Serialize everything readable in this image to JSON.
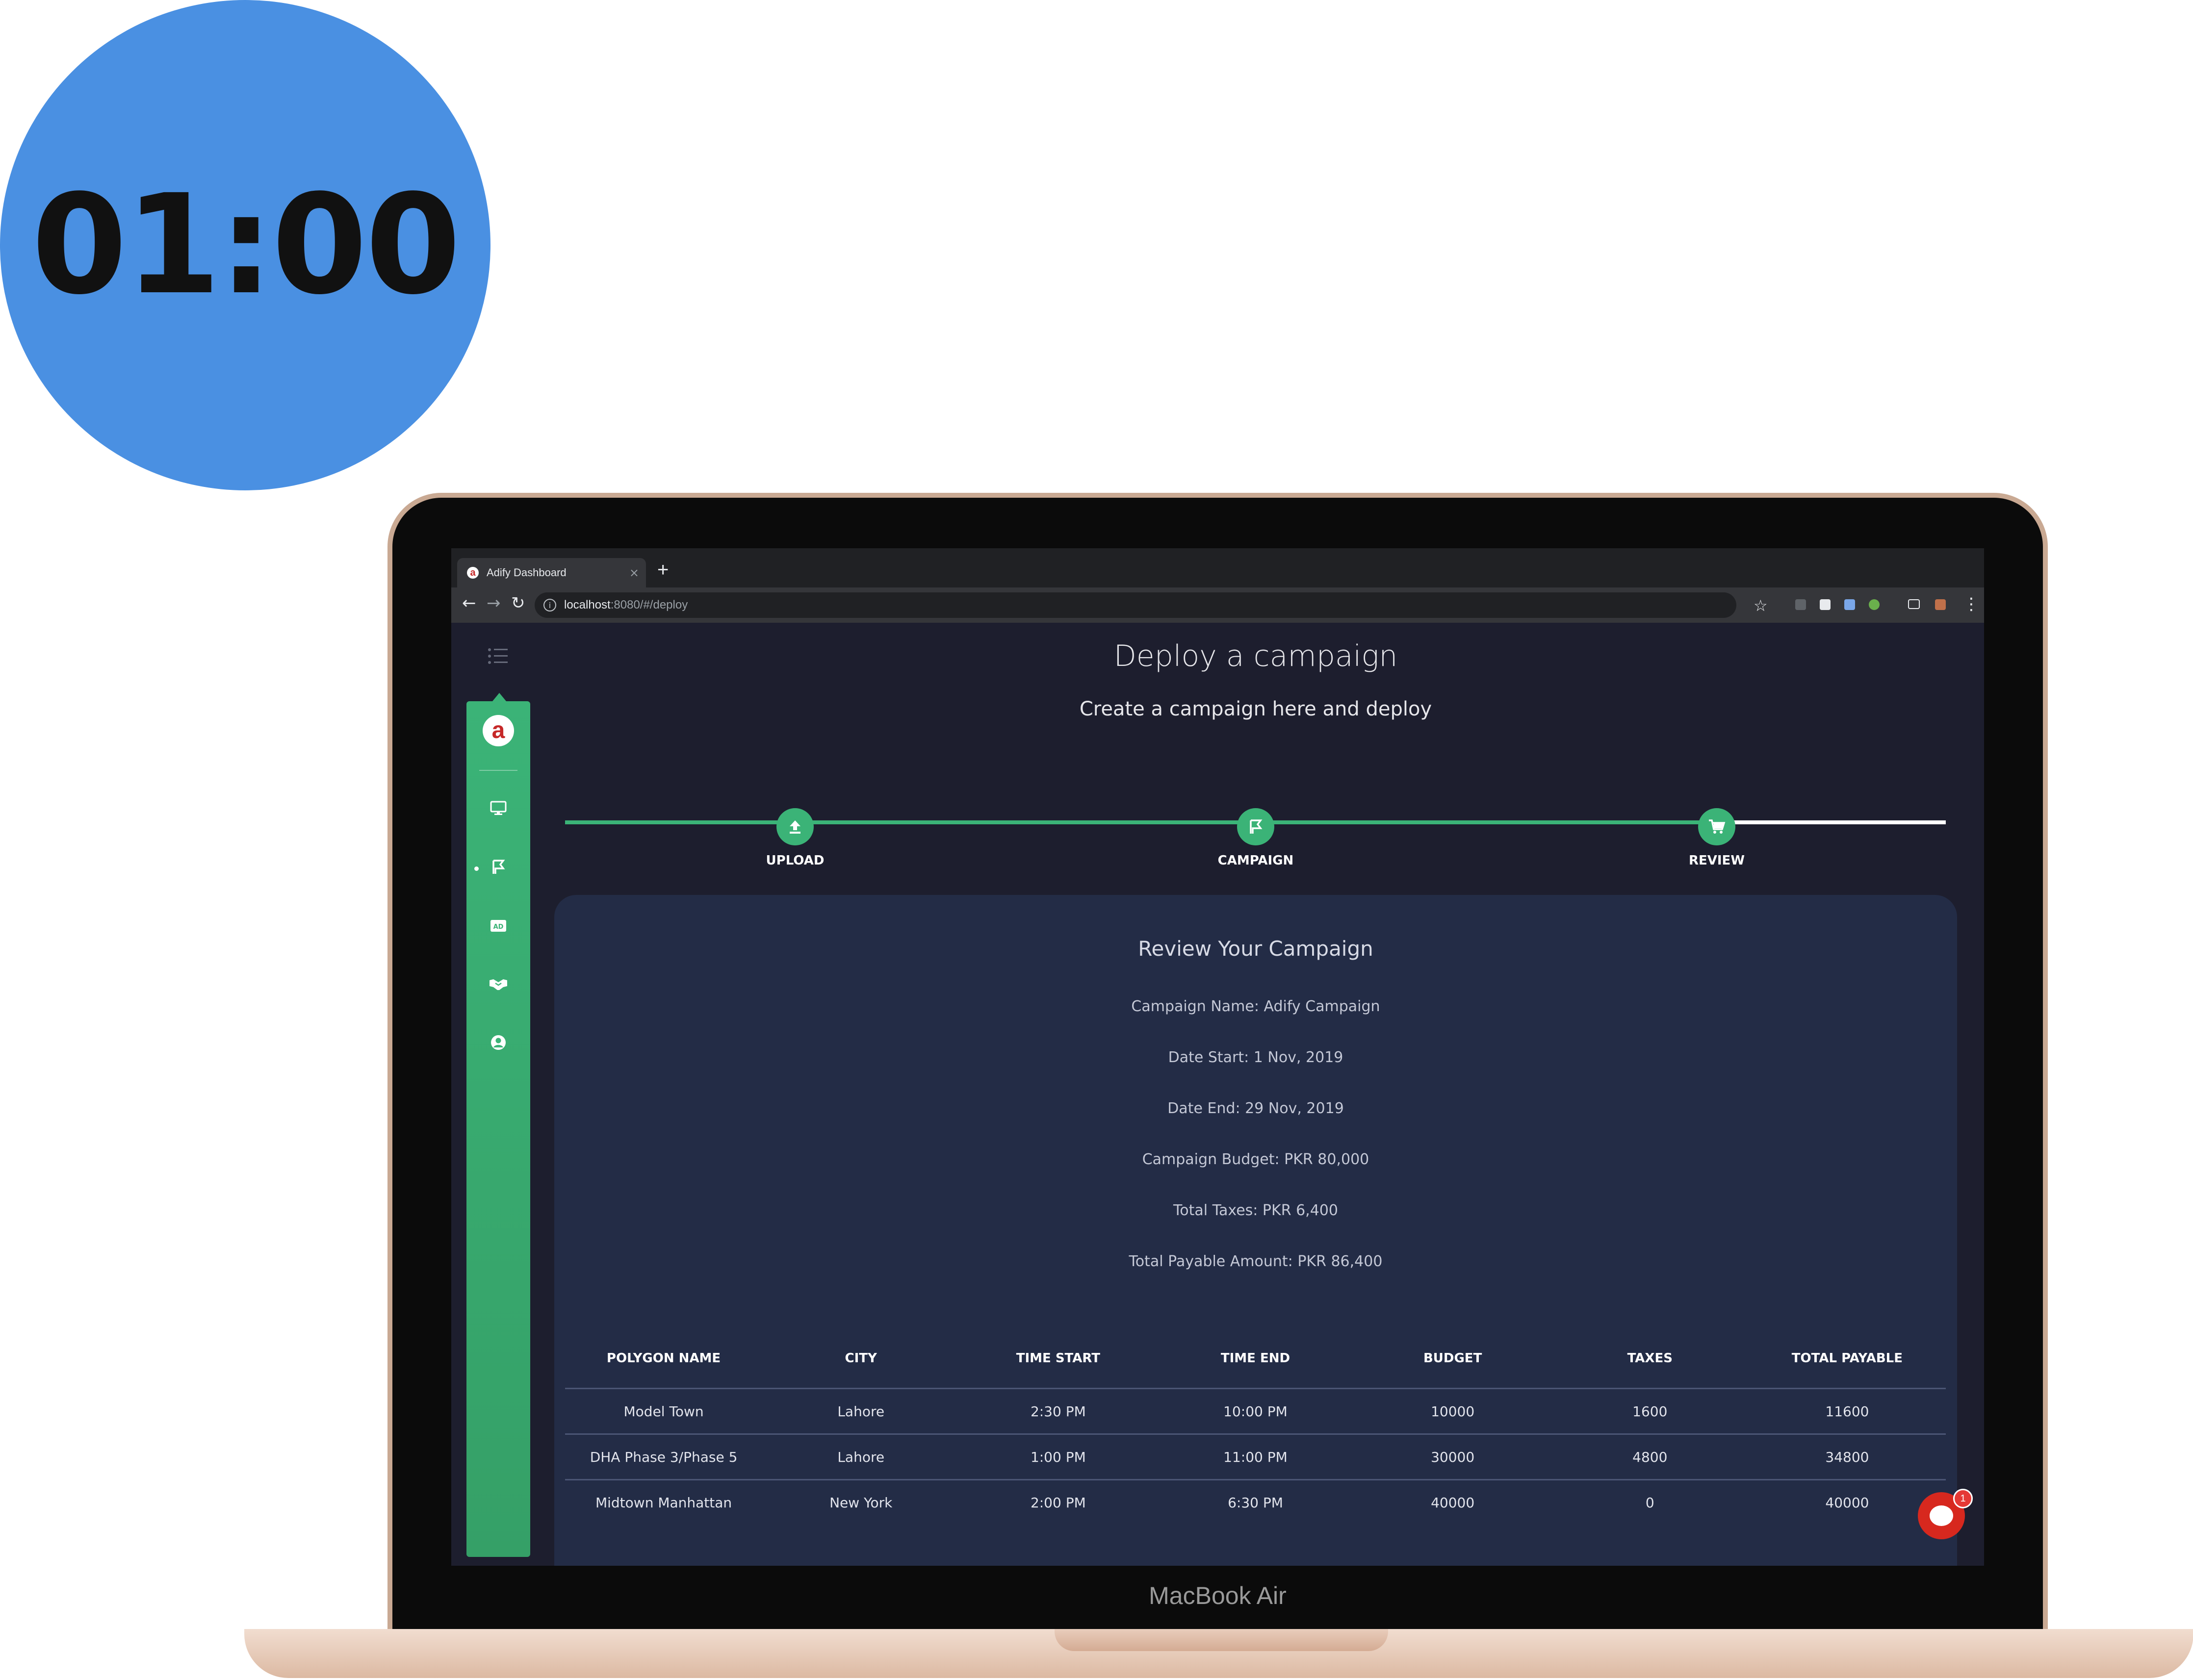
{
  "timer": {
    "value": "01:00"
  },
  "device": {
    "brand": "MacBook Air"
  },
  "browser": {
    "tab_title": "Adify Dashboard",
    "tab_close": "×",
    "new_tab": "+",
    "favicon_letter": "a",
    "url_host": "localhost",
    "url_path": ":8080/#/deploy"
  },
  "sidebar": {
    "logo_letter": "a",
    "items": [
      {
        "name": "dashboard",
        "icon": "monitor-icon"
      },
      {
        "name": "campaign",
        "icon": "flag-icon",
        "active": true
      },
      {
        "name": "ads",
        "icon": "ad-icon"
      },
      {
        "name": "partners",
        "icon": "handshake-icon"
      },
      {
        "name": "profile",
        "icon": "user-icon"
      }
    ],
    "accent": "#3bb377"
  },
  "page": {
    "title": "Deploy a campaign",
    "subtitle": "Create a campaign here and deploy"
  },
  "stepper": {
    "steps": [
      {
        "label": "UPLOAD",
        "icon": "upload-icon",
        "done": true
      },
      {
        "label": "CAMPAIGN",
        "icon": "flag-icon",
        "done": true
      },
      {
        "label": "REVIEW",
        "icon": "cart-icon",
        "done": true
      }
    ],
    "active_color": "#3bb377",
    "inactive_color": "#ffffff"
  },
  "review": {
    "title": "Review Your Campaign",
    "details": [
      "Campaign Name: Adify Campaign",
      "Date Start: 1 Nov, 2019",
      "Date End: 29 Nov, 2019",
      "Campaign Budget: PKR 80,000",
      "Total Taxes: PKR 6,400",
      "Total Payable Amount: PKR 86,400"
    ]
  },
  "table": {
    "headers": [
      "POLYGON NAME",
      "CITY",
      "TIME START",
      "TIME END",
      "BUDGET",
      "TAXES",
      "TOTAL PAYABLE"
    ],
    "rows": [
      [
        "Model Town",
        "Lahore",
        "2:30 PM",
        "10:00 PM",
        "10000",
        "1600",
        "11600"
      ],
      [
        "DHA Phase 3/Phase 5",
        "Lahore",
        "1:00 PM",
        "11:00 PM",
        "30000",
        "4800",
        "34800"
      ],
      [
        "Midtown Manhattan",
        "New York",
        "2:00 PM",
        "6:30 PM",
        "40000",
        "0",
        "40000"
      ]
    ]
  },
  "chat": {
    "badge": "1"
  }
}
